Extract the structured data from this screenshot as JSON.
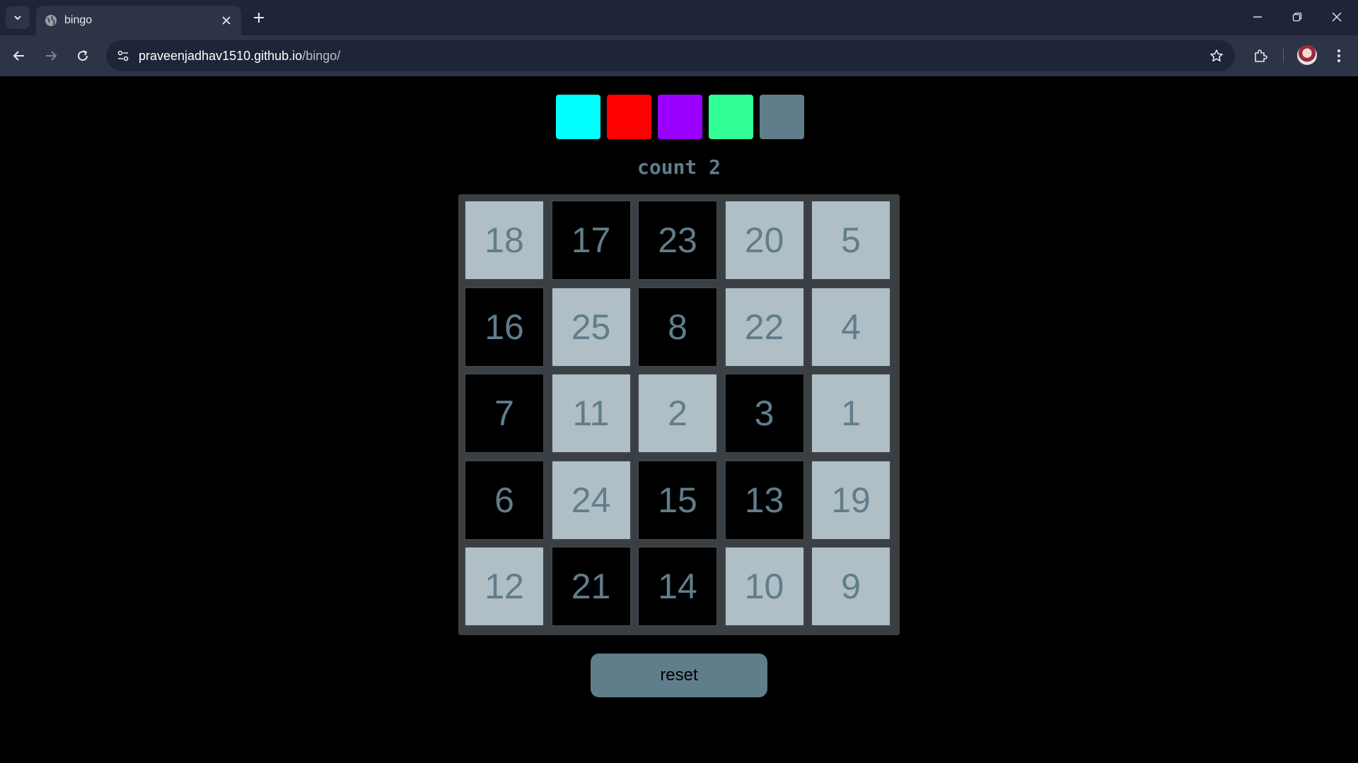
{
  "browser": {
    "tab_title": "bingo",
    "url_host": "praveenjadhav1510.github.io",
    "url_path": "/bingo/"
  },
  "page": {
    "swatches": [
      {
        "name": "cyan",
        "color": "#00ffff"
      },
      {
        "name": "red",
        "color": "#ff0000"
      },
      {
        "name": "purple",
        "color": "#9900ff"
      },
      {
        "name": "green",
        "color": "#33ff99"
      },
      {
        "name": "slate",
        "color": "#607d8b"
      }
    ],
    "count_label": "count 2",
    "board": [
      [
        {
          "n": "18",
          "on": true
        },
        {
          "n": "17",
          "on": false
        },
        {
          "n": "23",
          "on": false
        },
        {
          "n": "20",
          "on": true
        },
        {
          "n": "5",
          "on": true
        }
      ],
      [
        {
          "n": "16",
          "on": false
        },
        {
          "n": "25",
          "on": true
        },
        {
          "n": "8",
          "on": false
        },
        {
          "n": "22",
          "on": true
        },
        {
          "n": "4",
          "on": true
        }
      ],
      [
        {
          "n": "7",
          "on": false
        },
        {
          "n": "11",
          "on": true
        },
        {
          "n": "2",
          "on": true
        },
        {
          "n": "3",
          "on": false
        },
        {
          "n": "1",
          "on": true
        }
      ],
      [
        {
          "n": "6",
          "on": false
        },
        {
          "n": "24",
          "on": true
        },
        {
          "n": "15",
          "on": false
        },
        {
          "n": "13",
          "on": false
        },
        {
          "n": "19",
          "on": true
        }
      ],
      [
        {
          "n": "12",
          "on": true
        },
        {
          "n": "21",
          "on": false
        },
        {
          "n": "14",
          "on": false
        },
        {
          "n": "10",
          "on": true
        },
        {
          "n": "9",
          "on": true
        }
      ]
    ],
    "marked_color": "#b0bec5",
    "unmarked_color": "#000000",
    "number_color": "#607d8b",
    "reset_label": "reset"
  }
}
